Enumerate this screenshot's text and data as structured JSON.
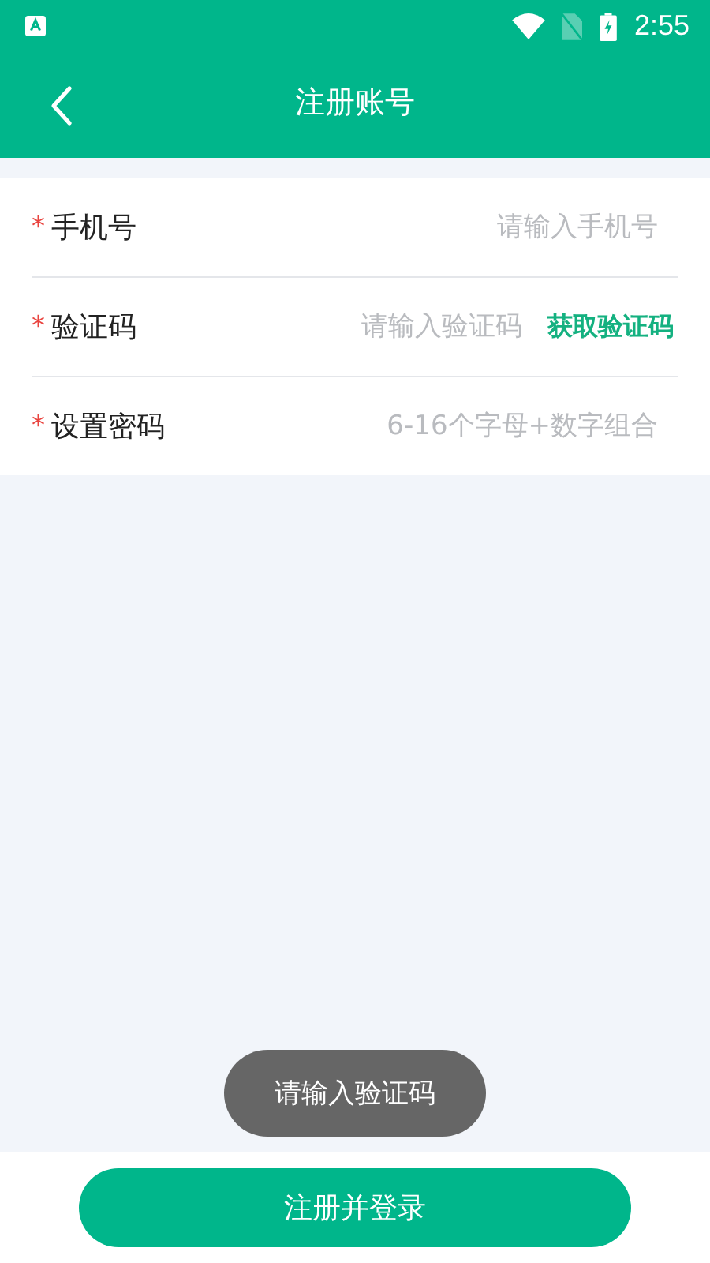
{
  "status_bar": {
    "time": "2:55"
  },
  "header": {
    "title": "注册账号"
  },
  "fields": [
    {
      "kind": "text",
      "label": "手机号",
      "required_mark": "*",
      "placeholder": "请输入手机号"
    },
    {
      "kind": "code",
      "label": "验证码",
      "required_mark": "*",
      "placeholder": "请输入验证码",
      "action": "获取验证码"
    },
    {
      "kind": "password",
      "label": "设置密码",
      "required_mark": "*",
      "placeholder": "6-16个字母+数字组合"
    }
  ],
  "toast": "请输入验证码",
  "submit_button": "注册并登录"
}
